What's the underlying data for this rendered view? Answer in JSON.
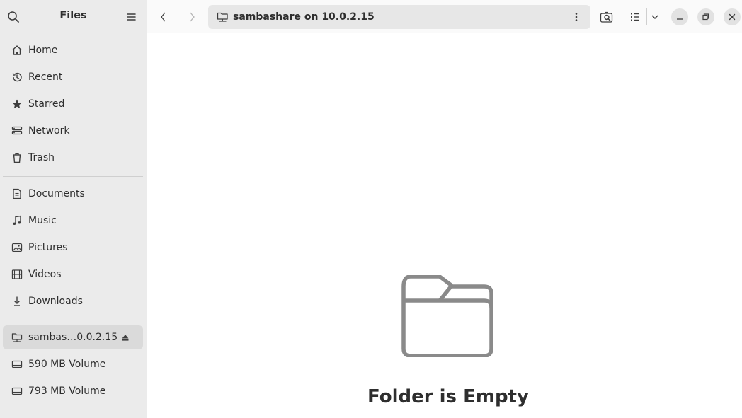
{
  "app": {
    "title": "Files"
  },
  "sidebar": {
    "places": [
      {
        "label": "Home",
        "icon": "home-icon"
      },
      {
        "label": "Recent",
        "icon": "recent-icon"
      },
      {
        "label": "Starred",
        "icon": "star-icon"
      },
      {
        "label": "Network",
        "icon": "network-icon"
      },
      {
        "label": "Trash",
        "icon": "trash-icon"
      }
    ],
    "bookmarks": [
      {
        "label": "Documents",
        "icon": "document-icon"
      },
      {
        "label": "Music",
        "icon": "music-icon"
      },
      {
        "label": "Pictures",
        "icon": "pictures-icon"
      },
      {
        "label": "Videos",
        "icon": "videos-icon"
      },
      {
        "label": "Downloads",
        "icon": "downloads-icon"
      }
    ],
    "devices": [
      {
        "label": "sambas…0.0.2.15",
        "icon": "network-folder-icon",
        "active": true,
        "eject": true
      },
      {
        "label": "590 MB Volume",
        "icon": "drive-icon"
      },
      {
        "label": "793 MB Volume",
        "icon": "drive-icon"
      }
    ]
  },
  "toolbar": {
    "location": "sambashare on 10.0.2.15"
  },
  "content": {
    "empty_title": "Folder is Empty"
  },
  "colors": {
    "sidebar_bg": "#ebebeb",
    "active_bg": "#dadada",
    "icon": "#3d3d3d",
    "empty_icon": "#8a8a8a"
  }
}
